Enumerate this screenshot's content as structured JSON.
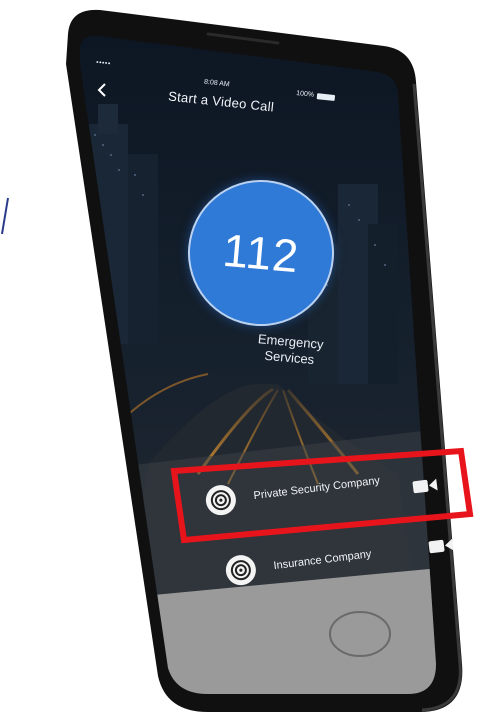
{
  "status_bar": {
    "signal": "•••••",
    "time": "8:08 AM",
    "battery": "100%"
  },
  "header": {
    "title": "Start a Video Call"
  },
  "emergency": {
    "number": "112",
    "label_line1": "Emergency",
    "label_line2": "Services"
  },
  "services": [
    {
      "label": "Private Security Company",
      "icon": "target-icon",
      "action_icon": "video-camera-icon",
      "highlighted": true
    },
    {
      "label": "Insurance Company",
      "icon": "target-icon",
      "action_icon": "video-camera-icon",
      "highlighted": false
    }
  ],
  "colors": {
    "primary_blue": "#2f7ad6",
    "highlight_red": "#e8141b",
    "phone_body": "#111111",
    "bottom_panel": "#9a9a9a"
  }
}
